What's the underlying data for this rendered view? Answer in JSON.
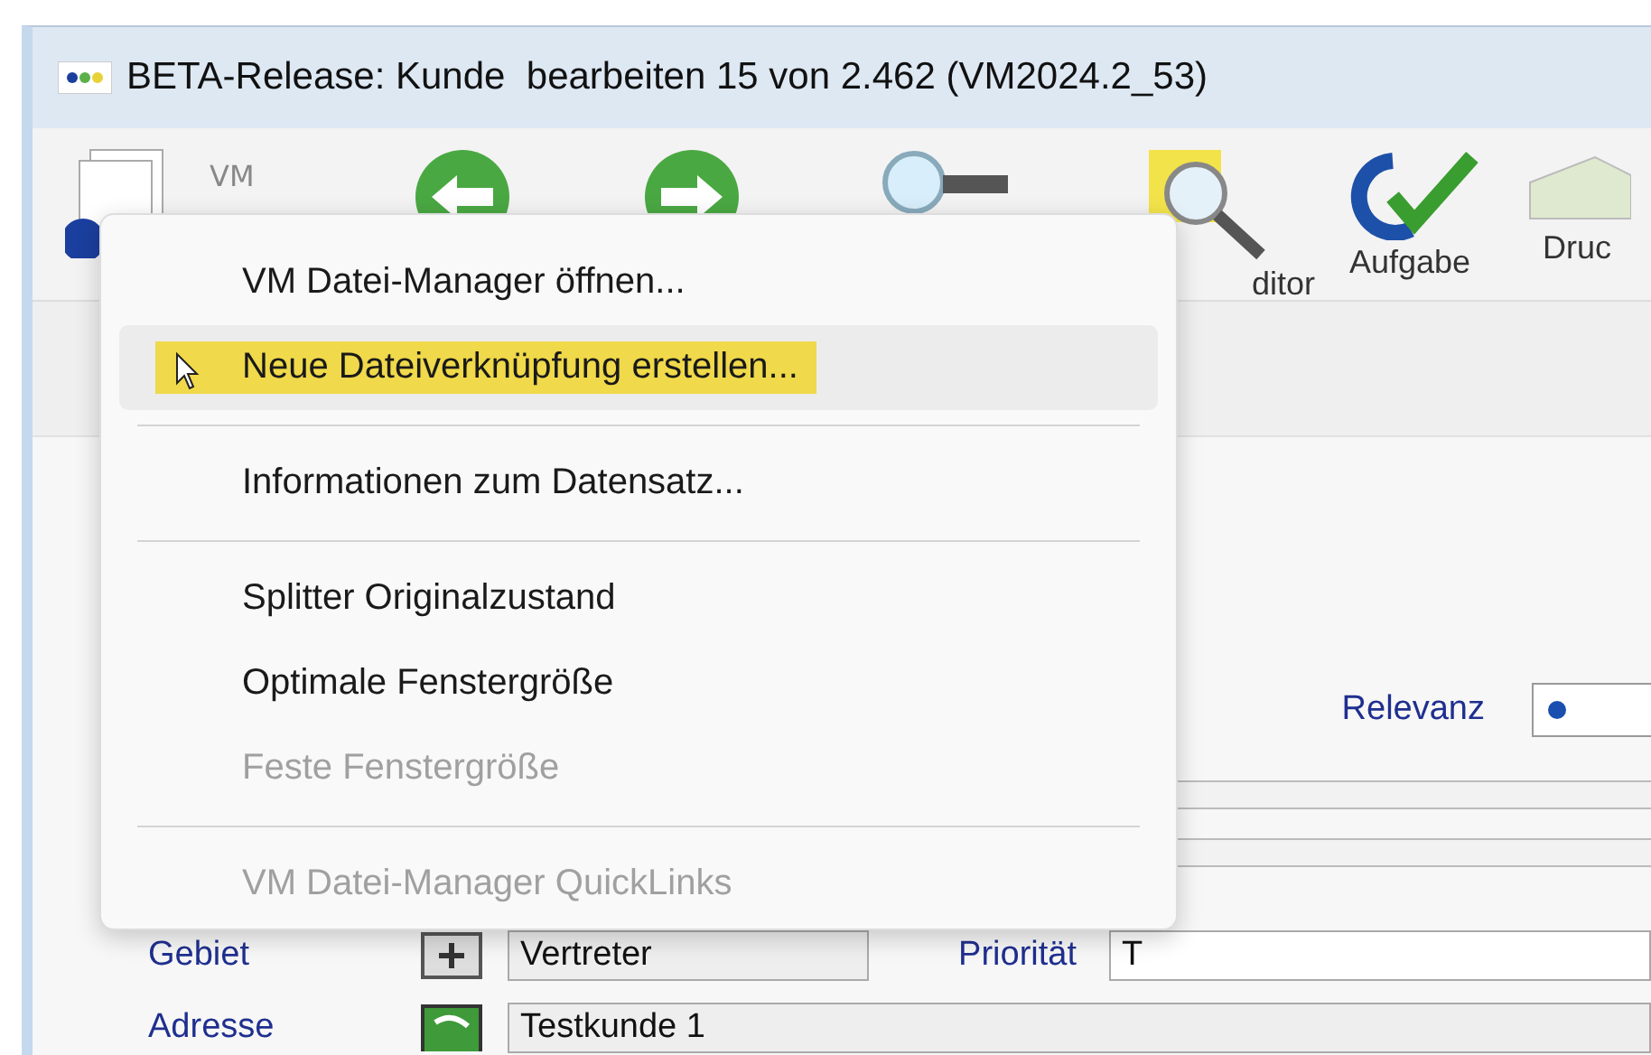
{
  "window": {
    "title": "BETA-Release: Kunde  bearbeiten 15 von 2.462 (VM2024.2_53)"
  },
  "toolbar": [
    {
      "kind": "docs",
      "badge": "VM"
    },
    {
      "kind": "back"
    },
    {
      "kind": "forward"
    },
    {
      "kind": "key"
    },
    {
      "kind": "editor",
      "label": "ditor"
    },
    {
      "kind": "task",
      "label": "Aufgabe"
    },
    {
      "kind": "print",
      "label": "Druc"
    }
  ],
  "form": {
    "relevanz": {
      "label": "Relevanz"
    },
    "rows": [
      {
        "label": "Gebiet",
        "value": "Vertreter",
        "extra_label": "Priorität",
        "extra_value": "T"
      },
      {
        "label": "Adresse",
        "value": "Testkunde 1"
      }
    ]
  },
  "context_menu": [
    {
      "kind": "item",
      "label": "VM Datei-Manager öffnen...",
      "selected": false,
      "disabled": false
    },
    {
      "kind": "item",
      "label": "Neue Dateiverknüpfung erstellen...",
      "selected": true,
      "disabled": false
    },
    {
      "kind": "separator"
    },
    {
      "kind": "item",
      "label": "Informationen zum Datensatz...",
      "selected": false,
      "disabled": false
    },
    {
      "kind": "separator"
    },
    {
      "kind": "item",
      "label": "Splitter Originalzustand",
      "selected": false,
      "disabled": false
    },
    {
      "kind": "item",
      "label": "Optimale Fenstergröße",
      "selected": false,
      "disabled": false
    },
    {
      "kind": "item",
      "label": "Feste Fenstergröße",
      "selected": false,
      "disabled": true
    },
    {
      "kind": "separator"
    },
    {
      "kind": "item",
      "label": "VM Datei-Manager QuickLinks",
      "selected": false,
      "disabled": true
    }
  ]
}
